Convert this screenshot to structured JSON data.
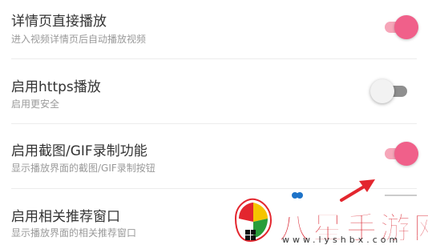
{
  "settings": [
    {
      "title": "详情页直接播放",
      "subtitle": "进入视频详情页后自动播放视频",
      "enabled": true
    },
    {
      "title": "启用https播放",
      "subtitle": "启用更安全",
      "enabled": false
    },
    {
      "title": "启用截图/GIF录制功能",
      "subtitle": "显示播放界面的截图/GIF录制按钮",
      "enabled": true
    },
    {
      "title": "启用相关推荐窗口",
      "subtitle": "显示播放界面的相关推荐窗口"
    }
  ],
  "colors": {
    "toggle_on": "#f0608a",
    "toggle_track_on": "#f6a6b9",
    "arrow": "#e3262e",
    "watermark": "#d81e2a"
  },
  "watermark": {
    "brand": "八星手游网",
    "url": "www.lyshbx.com"
  }
}
